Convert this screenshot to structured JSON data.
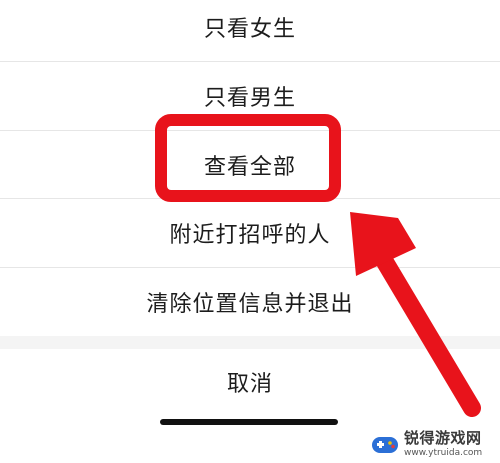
{
  "menu": {
    "items": [
      {
        "label": "只看女生"
      },
      {
        "label": "只看男生"
      },
      {
        "label": "查看全部"
      },
      {
        "label": "附近打招呼的人"
      },
      {
        "label": "清除位置信息并退出"
      }
    ],
    "cancel_label": "取消"
  },
  "annotation": {
    "highlighted_item": "查看全部",
    "color": "#e8131b"
  },
  "watermark": {
    "title": "锐得游戏网",
    "url": "www.ytruida.com"
  }
}
